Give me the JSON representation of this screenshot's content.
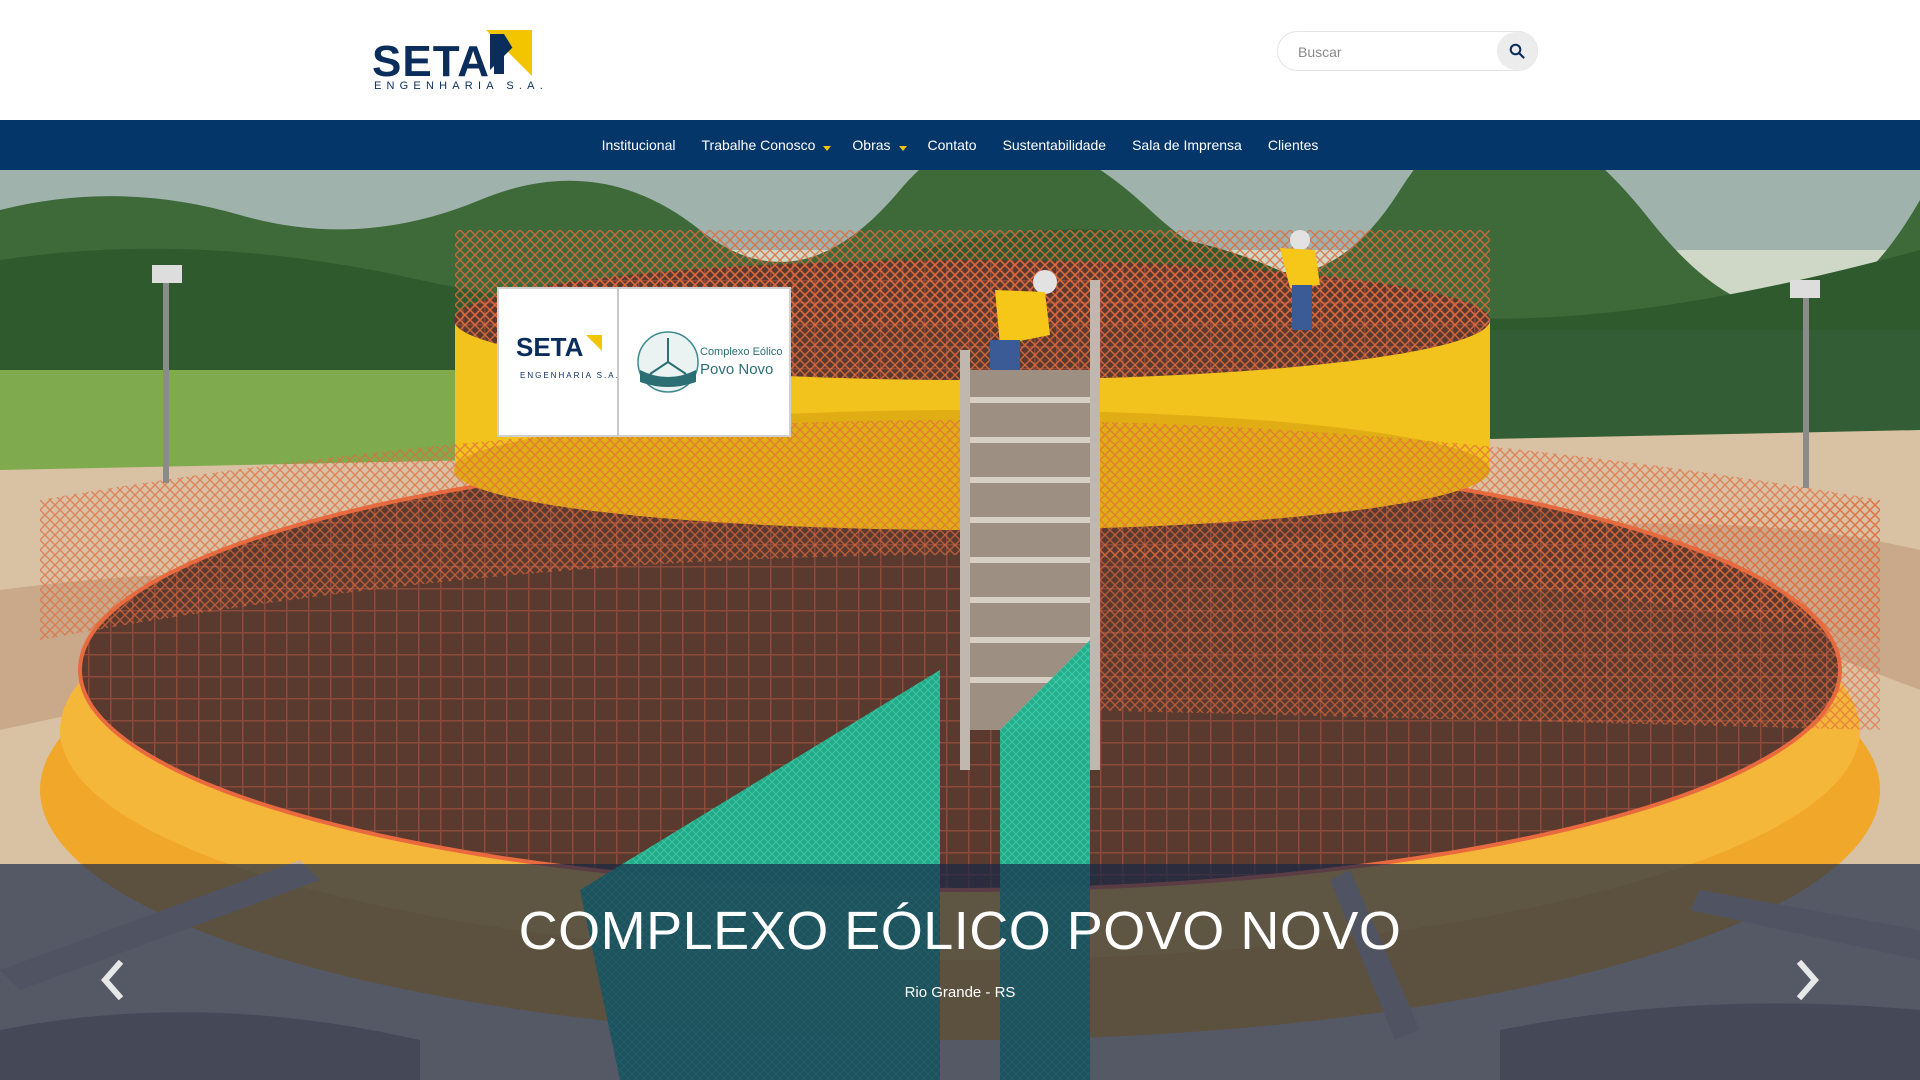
{
  "brand": {
    "name": "SETA",
    "tagline": "ENGENHARIA S.A.",
    "primary_color": "#04366a",
    "accent_color": "#f2c500"
  },
  "search": {
    "placeholder": "Buscar",
    "value": "",
    "icon": "search-icon"
  },
  "nav": {
    "items": [
      {
        "label": "Institucional",
        "dropdown": false
      },
      {
        "label": "Trabalhe Conosco",
        "dropdown": true
      },
      {
        "label": "Obras",
        "dropdown": true
      },
      {
        "label": "Contato",
        "dropdown": false
      },
      {
        "label": "Sustentabilidade",
        "dropdown": false
      },
      {
        "label": "Sala de Imprensa",
        "dropdown": false
      },
      {
        "label": "Clientes",
        "dropdown": false
      }
    ]
  },
  "hero": {
    "sign_brand": "SETA",
    "sign_brand_sub": "ENGENHARIA S.A.",
    "sign_project_line1": "Complexo Eólico",
    "sign_project_line2": "Povo Novo",
    "caption_title": "COMPLEXO EÓLICO POVO NOVO",
    "caption_subtitle": "Rio Grande - RS",
    "prev_icon": "chevron-left-icon",
    "next_icon": "chevron-right-icon"
  }
}
